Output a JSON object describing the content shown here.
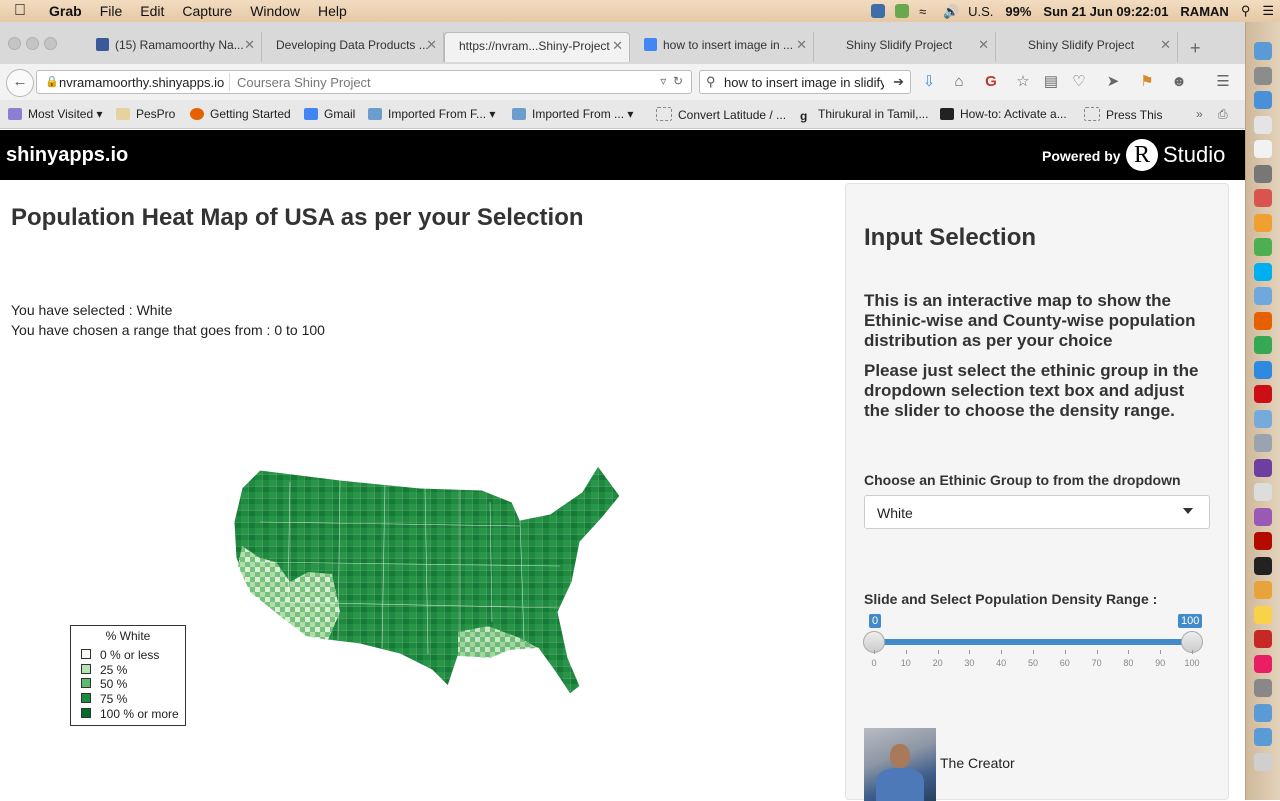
{
  "menubar": {
    "app": "Grab",
    "menus": [
      "File",
      "Edit",
      "Capture",
      "Window",
      "Help"
    ],
    "input_source": "U.S.",
    "battery": "99%",
    "clock": "Sun 21 Jun  09:22:01",
    "user": "RAMAN"
  },
  "tabs": [
    {
      "label": "(15) Ramamoorthy Na...",
      "favicon_color": "#3b5998"
    },
    {
      "label": "Developing Data Products ...",
      "favicon_color": ""
    },
    {
      "label": "https://nvram...Shiny-Project",
      "favicon_color": ""
    },
    {
      "label": "how to insert image in ...",
      "favicon_color": "#4285f4"
    },
    {
      "label": "Shiny Slidify Project",
      "favicon_color": ""
    },
    {
      "label": "Shiny Slidify Project",
      "favicon_color": ""
    }
  ],
  "navbar": {
    "url_domain": "nvramamoorthy.shinyapps.io",
    "page_title": "Coursera Shiny Project",
    "search_query": "how to  insert image in slidify"
  },
  "bookmarks": [
    "Most Visited",
    "PesPro",
    "Getting Started",
    "Gmail",
    "Imported From F...",
    "Imported From ...",
    "Convert Latitude / ...",
    "Thirukural in Tamil,...",
    "How-to: Activate a...",
    "Press This"
  ],
  "shiny_header": {
    "brand": "shinyapps.io",
    "powered_by": "Powered by",
    "rstudio": "Studio",
    "r_letter": "R"
  },
  "main": {
    "title": "Population Heat Map of USA as per your Selection",
    "selected_text": "You have selected : White",
    "range_text": "You have chosen a range that goes from : 0 to 100"
  },
  "legend": {
    "title": "% White",
    "items": [
      {
        "label": "0 % or less",
        "color": "#f7fcf5"
      },
      {
        "label": "25 %",
        "color": "#b7e2b1"
      },
      {
        "label": "50 %",
        "color": "#5db96b"
      },
      {
        "label": "75 %",
        "color": "#1e8a3f"
      },
      {
        "label": "100 % or more",
        "color": "#006d2c"
      }
    ]
  },
  "sidebar": {
    "heading": "Input Selection",
    "para1": "This is an interactive map to show the Ethinic-wise and County-wise population distribution as per your choice",
    "para2": "Please just select the ethinic group in the dropdown selection text box and adjust the slider to choose the density range.",
    "dropdown_label": "Choose an Ethinic Group to from the dropdown",
    "dropdown_value": "White",
    "slider_label": "Slide and Select Population Density Range :",
    "slider_min": 0,
    "slider_max": 100,
    "slider_low": "0",
    "slider_high": "100",
    "slider_ticks": [
      "0",
      "10",
      "20",
      "30",
      "40",
      "50",
      "60",
      "70",
      "80",
      "90",
      "100"
    ],
    "creator_label": "The Creator"
  },
  "colors": {
    "accent": "#428bca",
    "map_green": "#1e8a3f"
  }
}
